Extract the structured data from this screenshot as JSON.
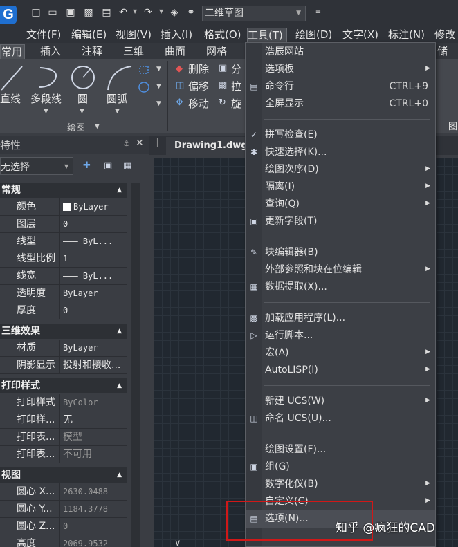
{
  "title_bar": {
    "logo_letter": "G",
    "workspace": "二维草图",
    "icons": [
      "new-file-icon",
      "open-folder-icon",
      "save-icon",
      "save-as-icon",
      "print-icon",
      "undo-icon",
      "redo-icon",
      "layers-icon",
      "headset-icon",
      "customize-icon"
    ]
  },
  "menu_bar": {
    "items": [
      {
        "label": "文件(F)"
      },
      {
        "label": "编辑(E)"
      },
      {
        "label": "视图(V)"
      },
      {
        "label": "插入(I)"
      },
      {
        "label": "格式(O)"
      },
      {
        "label": "工具(T)"
      },
      {
        "label": "绘图(D)"
      },
      {
        "label": "文字(X)"
      },
      {
        "label": "标注(N)"
      },
      {
        "label": "修改"
      }
    ]
  },
  "ribbon": {
    "tabs": [
      "常用",
      "插入",
      "注释",
      "三维",
      "曲面",
      "网格",
      "储"
    ],
    "draw_panel": {
      "title": "绘图",
      "buttons": [
        "直线",
        "多段线",
        "圆",
        "圆弧"
      ]
    },
    "modify_panel": {
      "buttons": [
        "删除",
        "分",
        "偏移",
        "拉",
        "移动",
        "旋"
      ],
      "side_label": "图"
    }
  },
  "properties": {
    "title": "特性",
    "selection": "无选择",
    "sections": [
      {
        "title": "常规",
        "rows": [
          {
            "key": "颜色",
            "value": "ByLayer",
            "swatch": "#ffffff"
          },
          {
            "key": "图层",
            "value": "0"
          },
          {
            "key": "线型",
            "value": "——— ByL..."
          },
          {
            "key": "线型比例",
            "value": "1"
          },
          {
            "key": "线宽",
            "value": "——— ByL..."
          },
          {
            "key": "透明度",
            "value": "ByLayer"
          },
          {
            "key": "厚度",
            "value": "0"
          }
        ]
      },
      {
        "title": "三维效果",
        "rows": [
          {
            "key": "材质",
            "value": "ByLayer"
          },
          {
            "key": "阴影显示",
            "value": "投射和接收..."
          }
        ]
      },
      {
        "title": "打印样式",
        "rows": [
          {
            "key": "打印样式",
            "value": "ByColor",
            "dim": true
          },
          {
            "key": "打印样...",
            "value": "无"
          },
          {
            "key": "打印表...",
            "value": "模型",
            "dim": true
          },
          {
            "key": "打印表...",
            "value": "不可用",
            "dim": true
          }
        ]
      },
      {
        "title": "视图",
        "rows": [
          {
            "key": "圆心 X...",
            "value": "2630.0488",
            "dim": true
          },
          {
            "key": "圆心 Y...",
            "value": "1184.3778",
            "dim": true
          },
          {
            "key": "圆心 Z...",
            "value": "0",
            "dim": true
          },
          {
            "key": "高度",
            "value": "2069.9532",
            "dim": true
          }
        ]
      }
    ]
  },
  "document_tab": {
    "label": "Drawing1.dwg"
  },
  "tools_menu": {
    "items": [
      {
        "label": "浩辰网站"
      },
      {
        "label": "选项板",
        "submenu": true
      },
      {
        "label": "命令行",
        "shortcut": "CTRL+9",
        "icon": "command-line-icon"
      },
      {
        "label": "全屏显示",
        "shortcut": "CTRL+0"
      },
      {
        "separator": true
      },
      {
        "label": "拼写检查(E)",
        "icon": "spell-check-icon"
      },
      {
        "label": "快速选择(K)...",
        "icon": "quick-select-icon"
      },
      {
        "label": "绘图次序(D)",
        "submenu": true
      },
      {
        "label": "隔离(I)",
        "submenu": true
      },
      {
        "label": "查询(Q)",
        "submenu": true
      },
      {
        "label": "更新字段(T)",
        "icon": "update-field-icon"
      },
      {
        "separator": true
      },
      {
        "label": "块编辑器(B)",
        "icon": "block-editor-icon"
      },
      {
        "label": "外部参照和块在位编辑",
        "submenu": true
      },
      {
        "label": "数据提取(X)...",
        "icon": "data-extraction-icon"
      },
      {
        "separator": true
      },
      {
        "label": "加载应用程序(L)...",
        "icon": "load-app-icon"
      },
      {
        "label": "运行脚本...",
        "icon": "run-script-icon"
      },
      {
        "label": "宏(A)",
        "submenu": true
      },
      {
        "label": "AutoLISP(I)",
        "submenu": true
      },
      {
        "separator": true
      },
      {
        "label": "新建 UCS(W)",
        "submenu": true
      },
      {
        "label": "命名 UCS(U)...",
        "icon": "named-ucs-icon"
      },
      {
        "separator": true
      },
      {
        "label": "绘图设置(F)..."
      },
      {
        "label": "组(G)",
        "icon": "group-icon"
      },
      {
        "label": "数字化仪(B)",
        "submenu": true
      },
      {
        "label": "自定义(C)",
        "submenu": true
      },
      {
        "label": "选项(N)...",
        "icon": "options-icon",
        "highlighted": true
      }
    ]
  },
  "watermark": "知乎 @疯狂的CAD",
  "colors": {
    "highlight_box": "#d01818",
    "accent": "#1f6fd0"
  }
}
